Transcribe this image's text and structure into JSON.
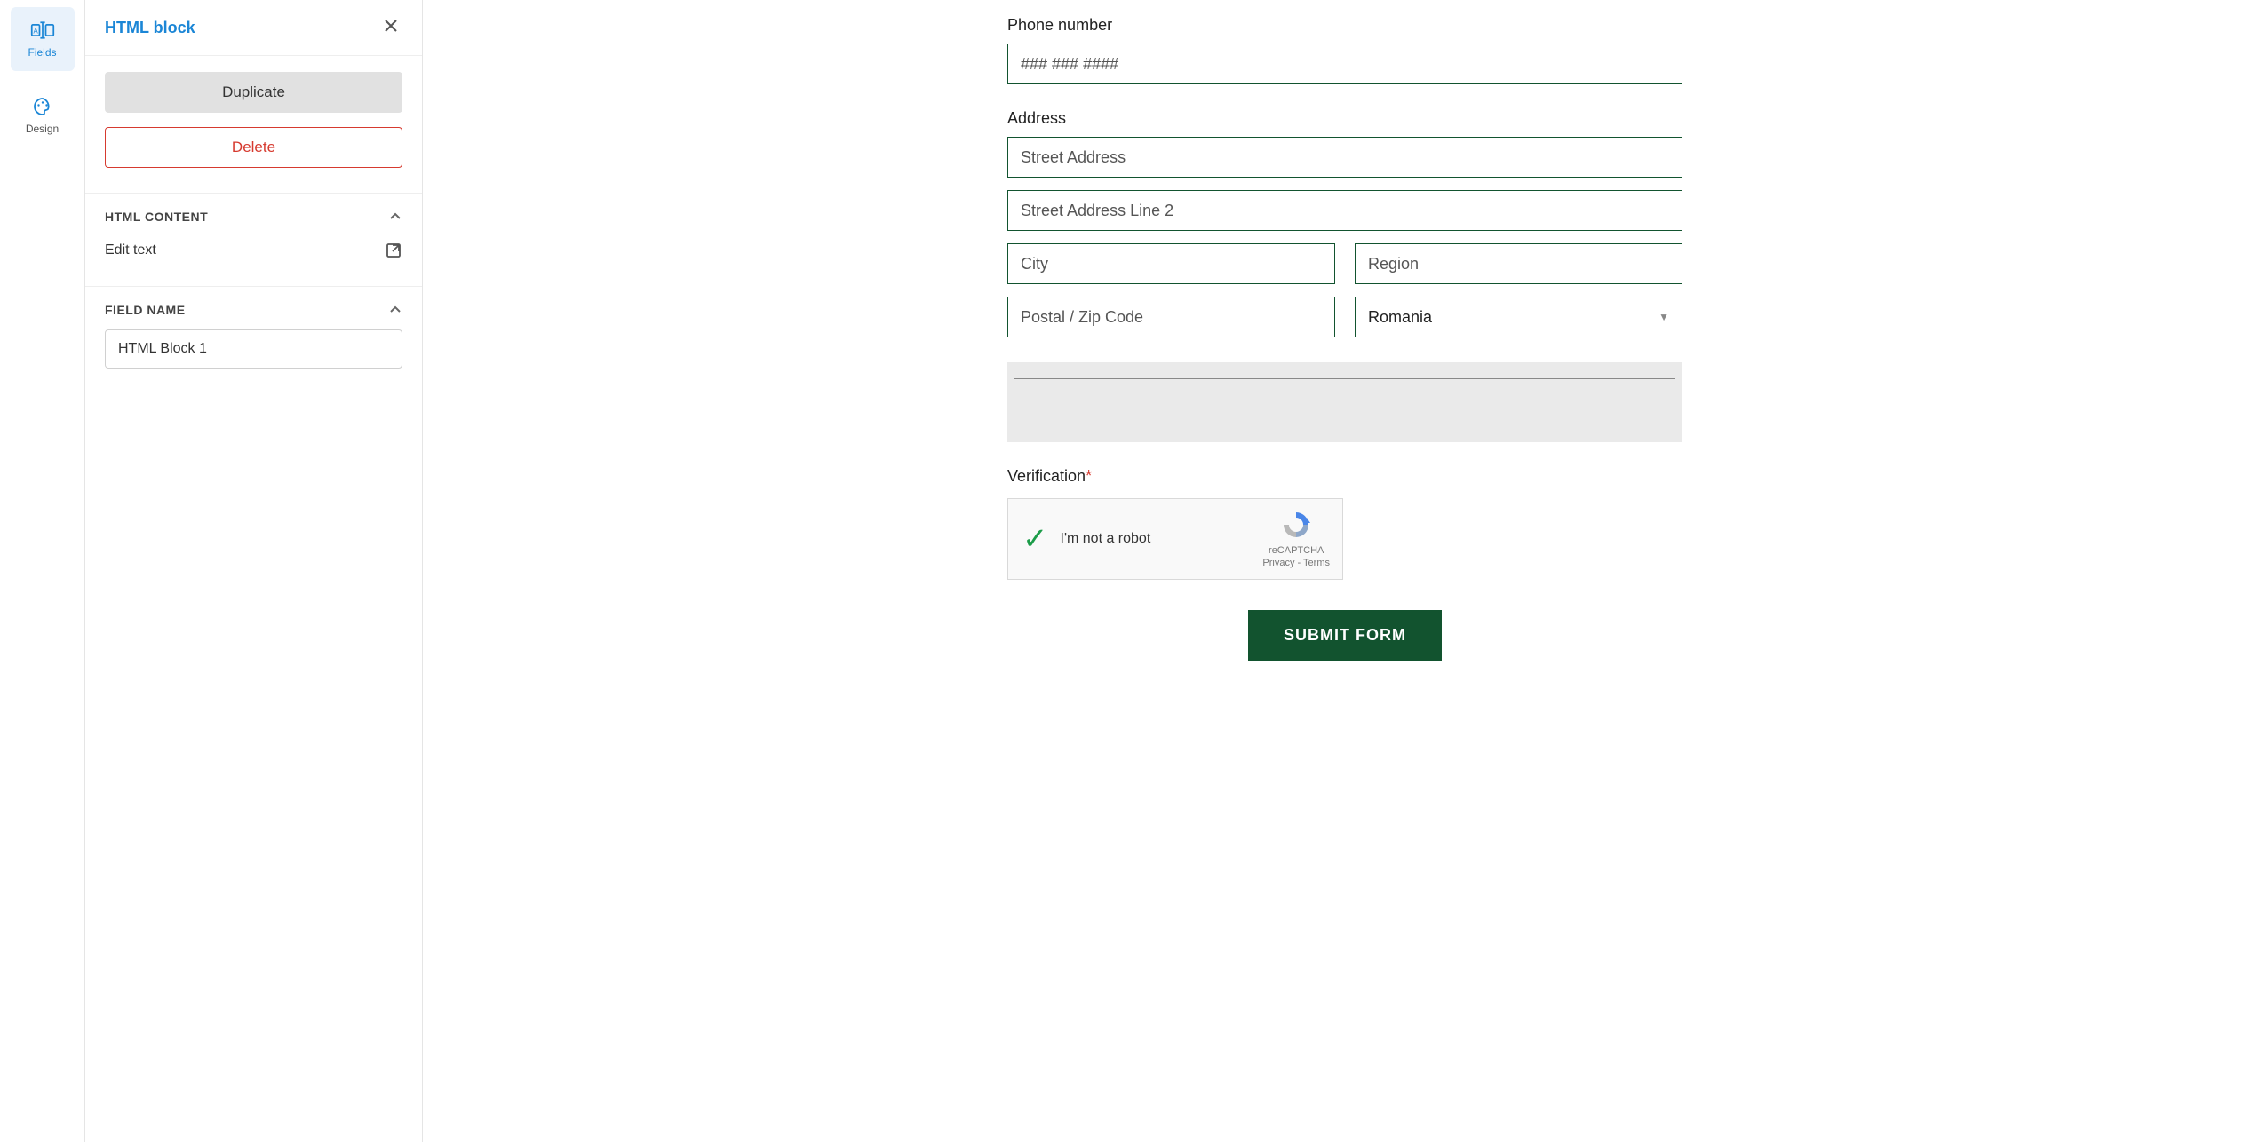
{
  "rail": {
    "fields": "Fields",
    "design": "Design"
  },
  "panel": {
    "title": "HTML block",
    "duplicate": "Duplicate",
    "delete": "Delete",
    "sections": {
      "html_content": {
        "title": "HTML CONTENT",
        "edit_text": "Edit text"
      },
      "field_name": {
        "title": "FIELD NAME",
        "value": "HTML Block 1"
      }
    }
  },
  "form": {
    "phone_label": "Phone number",
    "phone_placeholder": "### ### ####",
    "address_label": "Address",
    "address": {
      "street_placeholder": "Street Address",
      "street2_placeholder": "Street Address Line 2",
      "city_placeholder": "City",
      "region_placeholder": "Region",
      "postal_placeholder": "Postal / Zip Code",
      "country_value": "Romania"
    },
    "verification_label": "Verification",
    "recaptcha": {
      "text": "I'm not a robot",
      "brand": "reCAPTCHA",
      "links": "Privacy - Terms"
    },
    "submit": "SUBMIT FORM"
  },
  "colors": {
    "accent": "#1b86d6",
    "form_border": "#12532f",
    "danger": "#d63a2f",
    "selected_bg": "#eaeaea"
  }
}
